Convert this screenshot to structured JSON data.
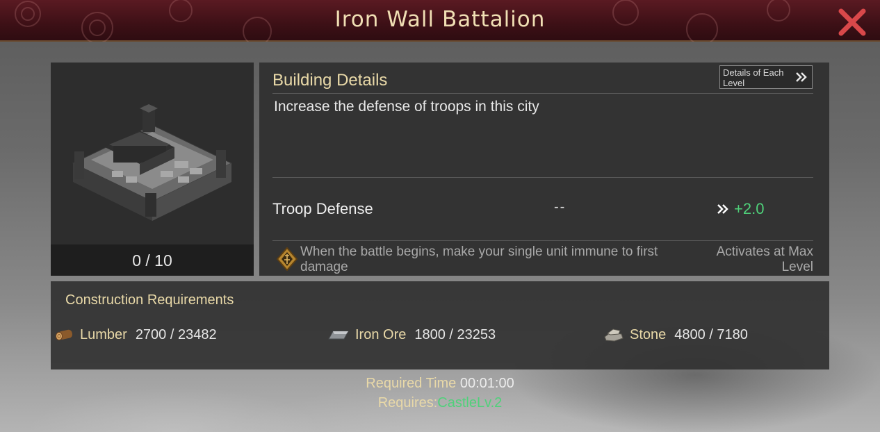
{
  "header": {
    "title": "Iron Wall Battalion"
  },
  "building": {
    "level": "0 / 10"
  },
  "details": {
    "title": "Building Details",
    "level_button_label": "Details of Each Level",
    "description": "Increase the defense of troops in this city",
    "stat": {
      "name": "Troop Defense",
      "current": "--",
      "next": "+2.0"
    },
    "skill": {
      "text": "When the battle begins, make your single unit immune to first damage",
      "activation": "Activates at Max Level"
    }
  },
  "requirements": {
    "title": "Construction Requirements",
    "resources": [
      {
        "name": "Lumber",
        "count": "2700 / 23482",
        "icon": "lumber-icon"
      },
      {
        "name": "Iron Ore",
        "count": "1800 / 23253",
        "icon": "iron-ore-icon"
      },
      {
        "name": "Stone",
        "count": "4800 / 7180",
        "icon": "stone-icon"
      }
    ]
  },
  "footer": {
    "time_label": "Required Time",
    "time_value": "00:01:00",
    "requires_label": "Requires:",
    "requires_value": "CastleLv.2"
  },
  "colors": {
    "accent_gold": "#e9d9a8",
    "positive_green": "#4fd17a",
    "close_red": "#d9484a"
  }
}
